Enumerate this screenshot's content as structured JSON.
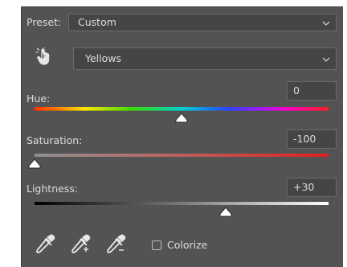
{
  "preset": {
    "label": "Preset:",
    "value": "Custom",
    "icon": "chevron-down-icon"
  },
  "targeted_adjust": {
    "icon": "hand-pointer-icon"
  },
  "channel": {
    "value": "Yellows",
    "icon": "chevron-down-icon"
  },
  "hue": {
    "label": "Hue:",
    "value": "0",
    "slider_fraction": 0.5
  },
  "saturation": {
    "label": "Saturation:",
    "value": "-100",
    "slider_fraction": 0.0
  },
  "lightness": {
    "label": "Lightness:",
    "value": "+30",
    "slider_fraction": 0.65
  },
  "tools": {
    "eyedropper_icon": "eyedropper-icon",
    "add_icon": "eyedropper-plus-icon",
    "subtract_icon": "eyedropper-minus-icon"
  },
  "colorize": {
    "label": "Colorize",
    "checked": false
  },
  "colors": {
    "panel_bg": "#535353",
    "field_bg": "#454545",
    "text": "#dcdcdc"
  }
}
